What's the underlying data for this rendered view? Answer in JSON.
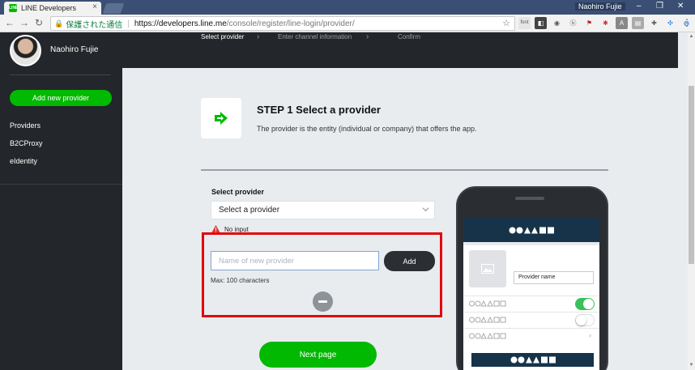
{
  "browser": {
    "tab_title": "LINE Developers",
    "tab_favicon_text": "LINE",
    "profile_name": "Naohiro Fujie",
    "secure_label": "保護された通信",
    "url_host": "https://developers.line.me",
    "url_path": "/console/register/line-login/provider/",
    "extensions": [
      "font",
      "pocket",
      "circle",
      "vine",
      "mendeley",
      "lastpass",
      "A",
      "note",
      "puzzle",
      "windmill",
      "globe",
      "iD"
    ]
  },
  "sidebar": {
    "user_name": "Naohiro Fujie",
    "add_provider_label": "Add new provider",
    "items": [
      {
        "label": "Providers"
      },
      {
        "label": "B2CProxy"
      },
      {
        "label": "eIdentity"
      }
    ]
  },
  "steps": [
    {
      "label": "Select provider",
      "active": true
    },
    {
      "label": "Enter channel information",
      "active": false
    },
    {
      "label": "Confirm",
      "active": false
    }
  ],
  "main": {
    "step_title": "STEP 1 Select a provider",
    "step_desc": "The provider is the entity (individual or company) that offers the app.",
    "select_label": "Select provider",
    "select_value": "Select a provider",
    "warning": "No input",
    "new_provider_placeholder": "Name of new provider",
    "add_label": "Add",
    "max_chars": "Max: 100 characters",
    "next_label": "Next page"
  },
  "preview": {
    "provider_name": "Provider name"
  },
  "colors": {
    "brand_green": "#00b900",
    "dark_bg": "#23262a",
    "highlight_red": "#e0080b",
    "phone_header": "#163349"
  }
}
